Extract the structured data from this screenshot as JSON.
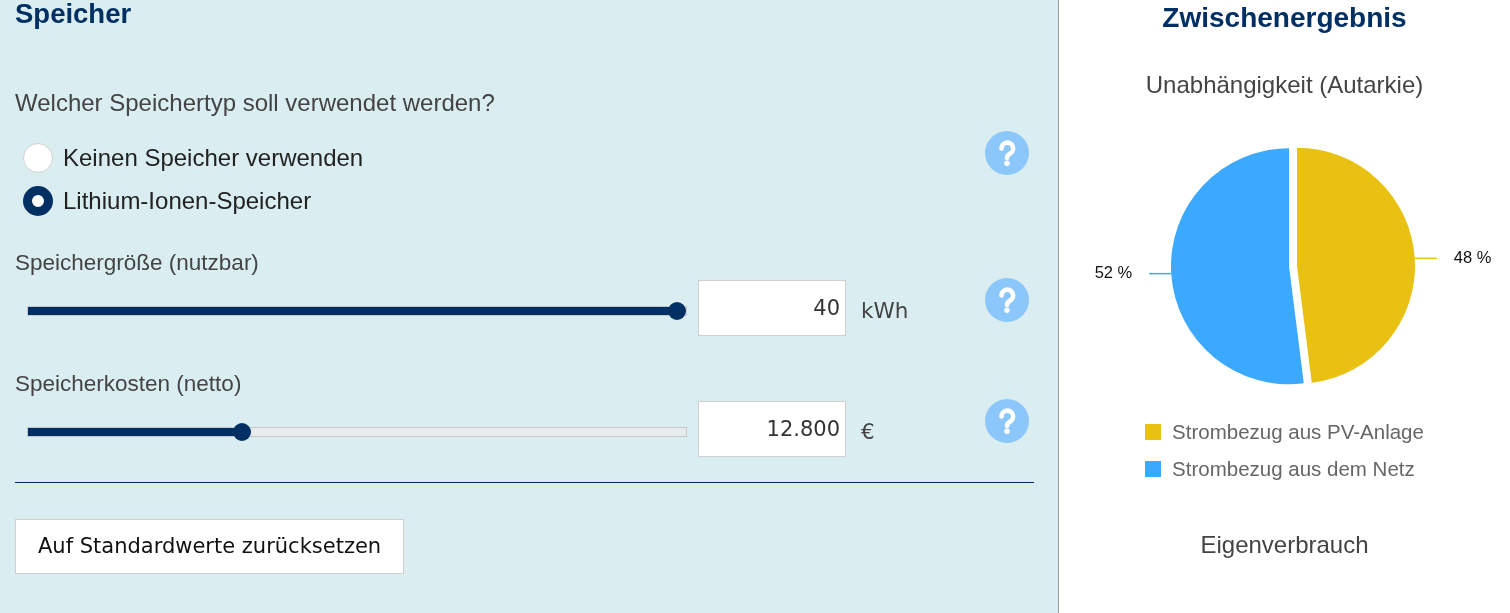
{
  "section": {
    "title": "Speicher"
  },
  "storage_type": {
    "question": "Welcher Speichertyp soll verwendet werden?",
    "options": [
      {
        "label": "Keinen Speicher verwenden",
        "selected": false
      },
      {
        "label": "Lithium-Ionen-Speicher",
        "selected": true
      }
    ]
  },
  "settings": [
    {
      "label": "Speichergröße (nutzbar)",
      "level": 1,
      "value": "40",
      "unit": "kWh"
    },
    {
      "label": "Speicherkosten (netto)",
      "level": 0.32,
      "value": "12.800",
      "unit": "€"
    }
  ],
  "reset_button": {
    "label": "Auf Standardwerte zurücksetzen"
  },
  "summary": {
    "title": "Zwischenergebnis",
    "chart_data": {
      "type": "pie",
      "title": "Unabhängigkeit (Autarkie)",
      "categories": [
        "Strombezug aus PV-Anlage",
        "Strombezug aus dem Netz"
      ],
      "values": [
        48,
        52
      ],
      "colors": [
        "#e9c112",
        "#3aa9fe"
      ],
      "value_labels": [
        "48 %",
        "52 %"
      ],
      "legend": "bottom"
    },
    "next_chart_title": "Eigenverbrauch"
  }
}
